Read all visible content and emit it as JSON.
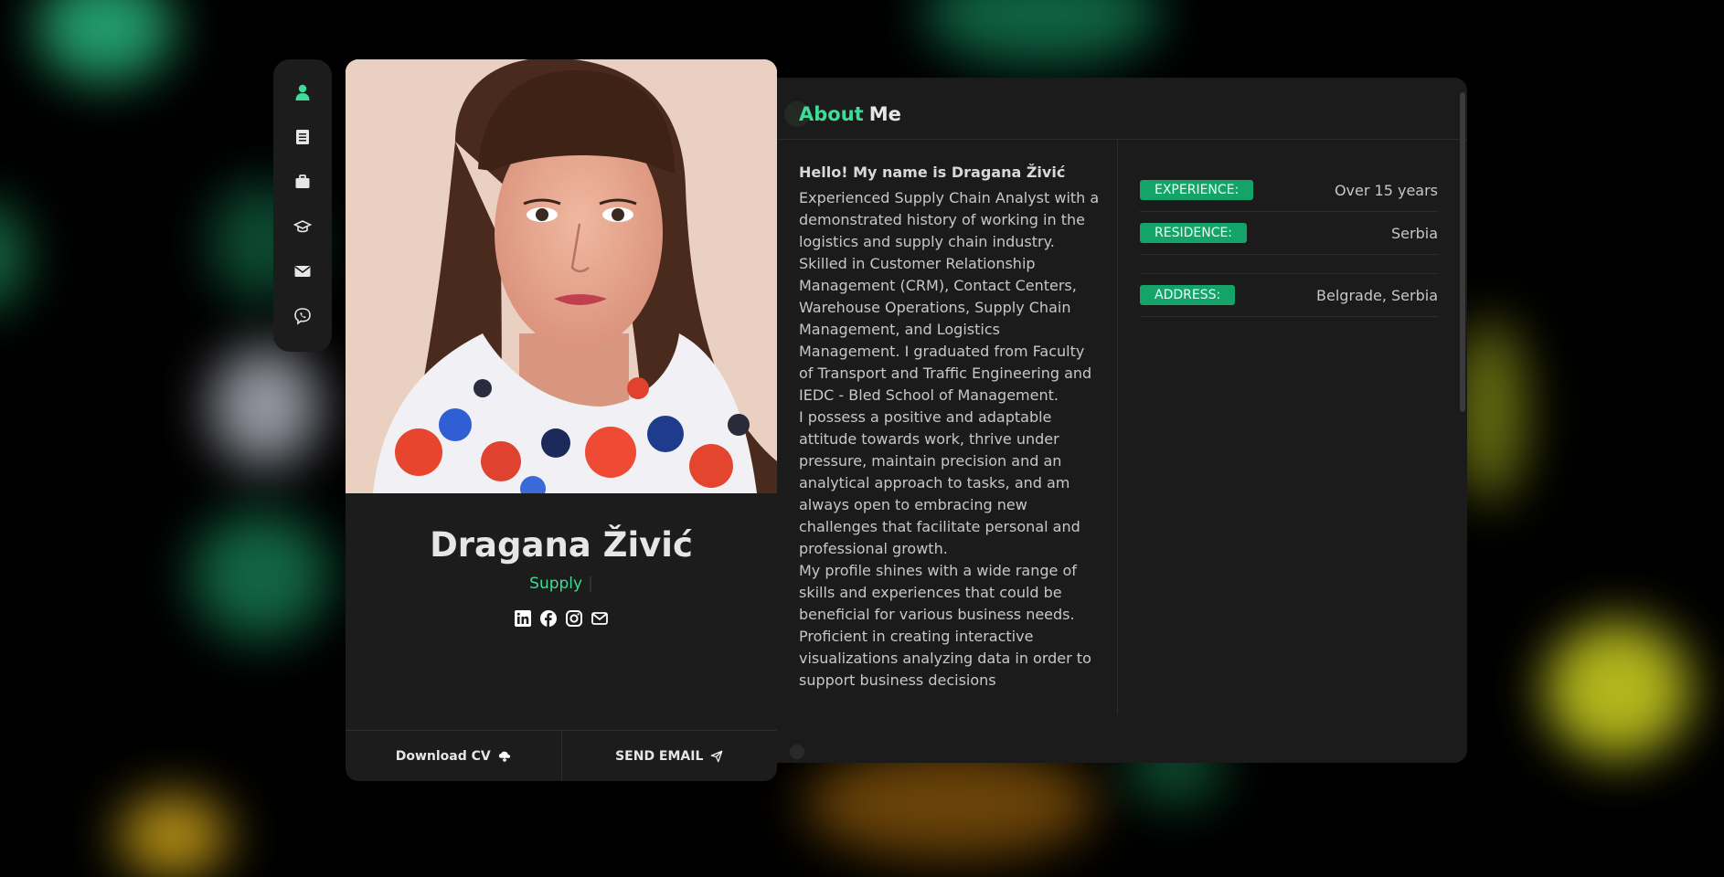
{
  "nav": {
    "items": [
      {
        "name": "nav-about",
        "icon": "user-icon",
        "active": true
      },
      {
        "name": "nav-resume",
        "icon": "document-icon",
        "active": false
      },
      {
        "name": "nav-portfolio",
        "icon": "briefcase-icon",
        "active": false
      },
      {
        "name": "nav-education",
        "icon": "graduation-cap-icon",
        "active": false
      },
      {
        "name": "nav-contact",
        "icon": "envelope-icon",
        "active": false
      },
      {
        "name": "nav-viber",
        "icon": "viber-icon",
        "active": false
      }
    ]
  },
  "profile": {
    "name": "Dragana Živić",
    "role": "Supply",
    "caret": "|",
    "socials": [
      "linkedin-icon",
      "facebook-icon",
      "instagram-icon",
      "email-icon"
    ],
    "download_label": "Download CV",
    "email_label": "SEND EMAIL"
  },
  "about": {
    "title_accent": "About",
    "title_rest": "Me",
    "greeting": "Hello! My name is Dragana Živić",
    "paragraphs": [
      "Experienced Supply Chain Analyst with a demonstrated history of working in the logistics and supply chain industry. Skilled in Customer Relationship Management (CRM), Contact Centers, Warehouse Operations, Supply Chain Management, and Logistics Management. I graduated from Faculty of Transport and Traffic Engineering and IEDC - Bled School of Management.",
      "I possess a positive and adaptable attitude towards work, thrive under pressure, maintain precision and an analytical approach to tasks, and am always open to embracing new challenges that facilitate personal and professional growth.",
      "My profile shines with a wide range of skills and experiences that could be beneficial for various business needs. Proficient in creating interactive visualizations analyzing data in order to support business decisions"
    ],
    "facts": [
      {
        "label": "EXPERIENCE:",
        "value": "Over 15 years"
      },
      {
        "label": "RESIDENCE:",
        "value": "Serbia"
      },
      {
        "label": "ADDRESS:",
        "value": "Belgrade, Serbia"
      }
    ]
  },
  "colors": {
    "accent": "#3ddc97",
    "tag": "#14a46a",
    "card": "#1c1c1c"
  }
}
